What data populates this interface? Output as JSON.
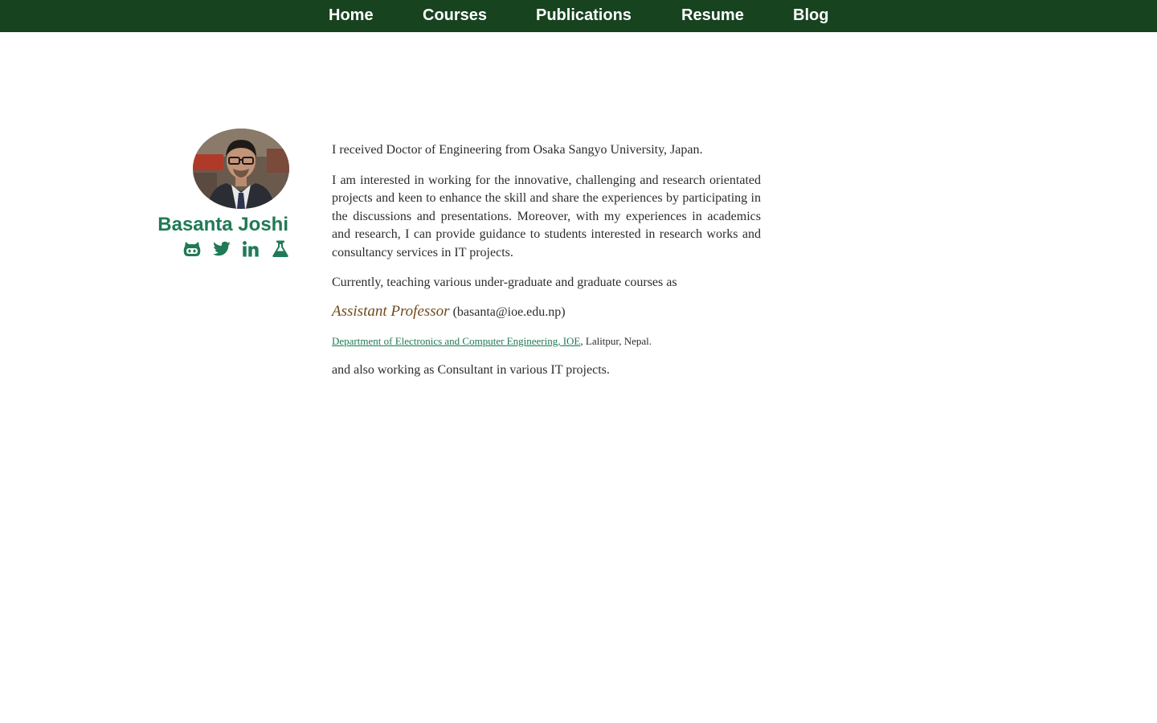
{
  "nav": {
    "items": [
      "Home",
      "Courses",
      "Publications",
      "Resume",
      "Blog"
    ]
  },
  "profile": {
    "name": "Basanta Joshi",
    "social_icons": [
      "github-icon",
      "twitter-icon",
      "linkedin-icon",
      "flask-icon"
    ]
  },
  "content": {
    "p1": "I received Doctor of Engineering from Osaka Sangyo University, Japan.",
    "p2": "I am interested in working for the innovative, challenging and research orientated projects and keen to enhance the skill and share the experiences by participating in the discussions and presentations. Moreover, with my experiences in academics and research, I can provide guidance to students interested in research works and consultancy services in IT projects.",
    "p3": "Currently, teaching various under-graduate and graduate courses as",
    "role": "Assistant Professor",
    "email": "(basanta@ioe.edu.np)",
    "dept_link": "Department of Electronics and Computer Engineering, IOE",
    "dept_suffix": ", Lalitpur, Nepal.",
    "p6": "and also working as Consultant in various IT projects."
  },
  "colors": {
    "nav_bg": "#17431f",
    "accent": "#1f7a55",
    "role": "#6e4b1d",
    "text": "#2c2c2c"
  }
}
